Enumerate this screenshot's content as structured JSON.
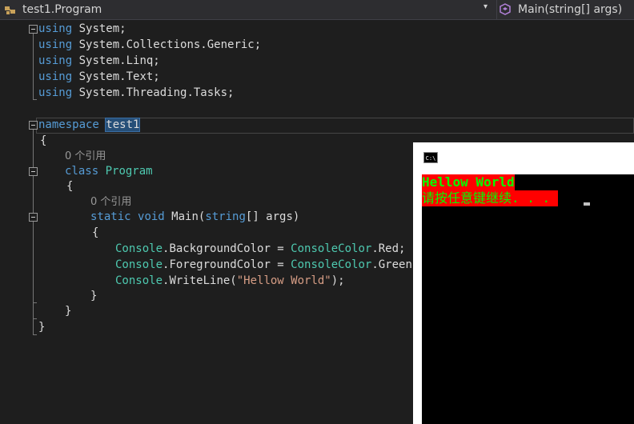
{
  "navbar": {
    "class_dropdown": "test1.Program",
    "member_dropdown": "Main(string[] args)",
    "dropdown_arrow": "▾"
  },
  "code": {
    "l1_kw": "using",
    "l1_rest": " System;",
    "l2_kw": "using",
    "l2_rest": " System.Collections.Generic;",
    "l3_kw": "using",
    "l3_rest": " System.Linq;",
    "l4_kw": "using",
    "l4_rest": " System.Text;",
    "l5_kw": "using",
    "l5_rest": " System.Threading.Tasks;",
    "ns_kw": "namespace",
    "ns_name": "test1",
    "open_brace": "{",
    "codelens_class": "0 个引用",
    "class_kw": "class",
    "class_name": "Program",
    "codelens_main": "0 个引用",
    "static_kw": "static",
    "void_kw": "void",
    "main_name": " Main(",
    "string_kw": "string",
    "main_args": "[] args)",
    "bg_console": "Console",
    "bg_mid": ".BackgroundColor = ",
    "bg_cc": "ConsoleColor",
    "bg_end": ".Red;",
    "fg_console": "Console",
    "fg_mid": ".ForegroundColor = ",
    "fg_cc": "ConsoleColor",
    "fg_end": ".Green;",
    "wl_console": "Console",
    "wl_mid": ".WriteLine(",
    "wl_str": "\"Hellow World\"",
    "wl_end": ");",
    "close_brace": "}"
  },
  "console": {
    "icon_label": "C:\\",
    "line1": "Hellow World",
    "line2": "请按任意键继续. . . ",
    "colors": {
      "background": "#ff0000",
      "foreground": "#00ff00",
      "prompt_fg": "#c0c0c0"
    }
  }
}
